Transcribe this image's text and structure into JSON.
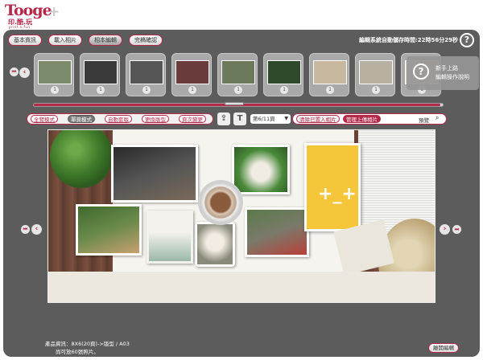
{
  "logo": {
    "brand": "Tooge",
    "plus": "+",
    "chinese": "印.酷.玩",
    "sub": "print.n.fun"
  },
  "top_buttons": [
    {
      "label": "基本資訊"
    },
    {
      "label": "載入相片"
    },
    {
      "label": "相本編輯"
    },
    {
      "label": "完稿確認"
    }
  ],
  "timer": "編輯系統自動儲存時間:22時56分29秒",
  "help": "?",
  "tooltip": {
    "icon": "?",
    "line1": "新手上路",
    "line2": "編輯操作說明"
  },
  "thumbnails": [
    {
      "num": "1",
      "color": "#7a8a6a"
    },
    {
      "num": "1",
      "color": "#3a3a3a"
    },
    {
      "num": "1",
      "color": "#555555"
    },
    {
      "num": "1",
      "color": "#6b3a3a"
    },
    {
      "num": "1",
      "color": "#6a7a5a"
    },
    {
      "num": "1",
      "color": "#2e4a2a"
    },
    {
      "num": "1",
      "color": "#c8b8a0"
    },
    {
      "num": "1",
      "color": "#b8b0a0"
    },
    {
      "num": "1",
      "color": "#e0d8c8"
    }
  ],
  "layout_modes": [
    {
      "label": "全覽模式"
    },
    {
      "label": "單頁模式"
    },
    {
      "label": "自動套版"
    },
    {
      "label": "更換版型"
    },
    {
      "label": "頁次變更"
    }
  ],
  "tool_icons": {
    "upload": "⇪",
    "text": "T"
  },
  "page_select": {
    "value": "第6/11頁",
    "arrow": "▼"
  },
  "photo_actions": [
    {
      "label": "清除已置入相片"
    },
    {
      "label": "管理上傳相片"
    }
  ],
  "preview_link": "預覽",
  "search_icon": "⌕",
  "nav": {
    "first": "⏮",
    "prev": "‹",
    "next": "›",
    "last": "⏭"
  },
  "canvas": {
    "yellow_mark": "+_+"
  },
  "footer": {
    "product_info": "產品資訊：8X6(20頁)->版型 / A03",
    "photo_limit": "尚可放60張照片。",
    "exit_label": "離開編輯"
  },
  "colors": {
    "brand": "#b4294a",
    "panel": "#5c5c5c"
  }
}
